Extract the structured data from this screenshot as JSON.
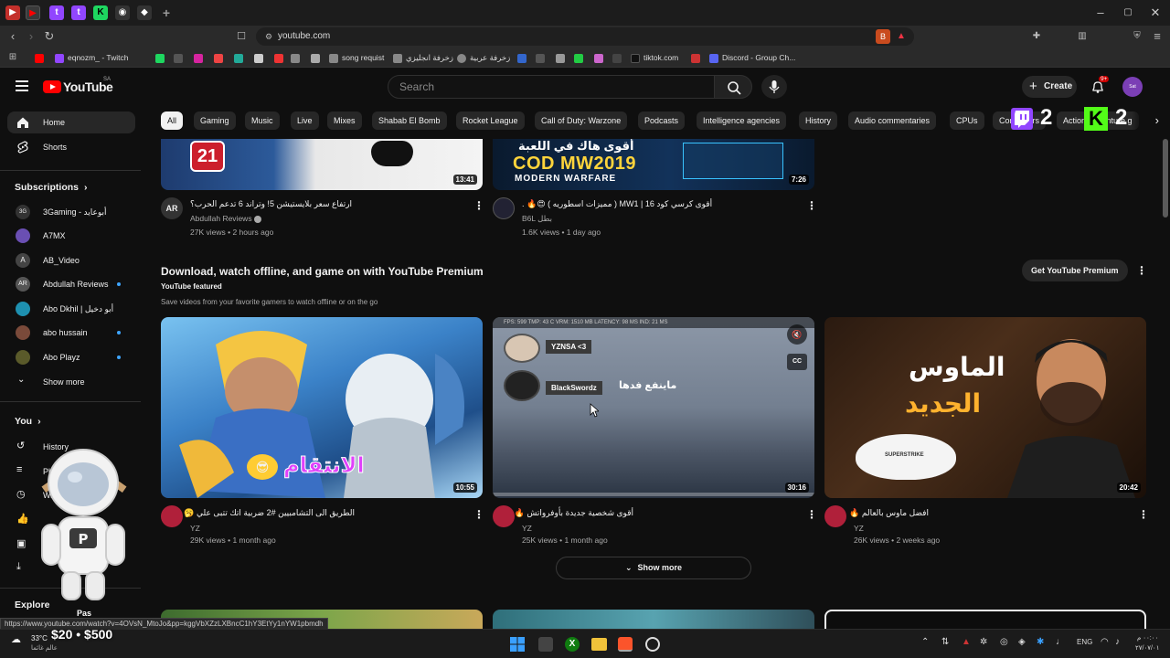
{
  "browser": {
    "url": "youtube.com",
    "bookmarks": [
      {
        "label": "eqnozm_ - Twitch",
        "color": "#9146ff"
      },
      {
        "label": "song requist",
        "color": "#888888"
      },
      {
        "label": "زخرفة انجليزي",
        "color": "#888888"
      },
      {
        "label": "زخرفة عربية",
        "color": "#888888"
      },
      {
        "label": "tiktok.com",
        "color": "#111111"
      },
      {
        "label": "Discord - Group Ch...",
        "color": "#5865f2"
      }
    ]
  },
  "youtube": {
    "logo_text": "YouTube",
    "region": "SA",
    "search_placeholder": "Search",
    "create_label": "Create",
    "notif_count": "9+",
    "avatar_text": "Sat"
  },
  "chips": [
    {
      "label": "All",
      "active": true
    },
    {
      "label": "Gaming"
    },
    {
      "label": "Music"
    },
    {
      "label": "Live"
    },
    {
      "label": "Mixes"
    },
    {
      "label": "Shabab El Bomb"
    },
    {
      "label": "Rocket League"
    },
    {
      "label": "Call of Duty: Warzone"
    },
    {
      "label": "Podcasts"
    },
    {
      "label": "Intelligence agencies"
    },
    {
      "label": "History"
    },
    {
      "label": "Audio commentaries"
    },
    {
      "label": "CPUs"
    },
    {
      "label": "Computers"
    },
    {
      "label": "Action-adventure g"
    }
  ],
  "sidebar": {
    "home": "Home",
    "shorts": "Shorts",
    "subscriptions_title": "Subscriptions",
    "subscriptions": [
      {
        "name": "3Gaming - أبوعايد",
        "color": "#333333",
        "dot": false
      },
      {
        "name": "A7MX",
        "color": "#6a4fb3",
        "dot": false
      },
      {
        "name": "AB_Video",
        "color": "#444444",
        "dot": false
      },
      {
        "name": "Abdullah Reviews",
        "color": "#555555",
        "dot": true
      },
      {
        "name": "Abo Dkhil | أبو دخيل",
        "color": "#1e90b0",
        "dot": false
      },
      {
        "name": "abo hussain",
        "color": "#7a4a3a",
        "dot": true
      },
      {
        "name": "Abo Playz",
        "color": "#5a5a2a",
        "dot": true
      }
    ],
    "show_more": "Show more",
    "you_title": "You",
    "you_items": [
      "History",
      "Playlists",
      "Watch later"
    ],
    "explore": "Explore"
  },
  "top_videos": [
    {
      "title": "ارتفاع سعر بلايستيشن 5! وتراند 6 تدعم الحرب؟",
      "channel": "Abdullah Reviews",
      "stats": "27K views • 2 hours ago",
      "duration": "13:41",
      "thumb_text": "21"
    },
    {
      "title": "أقوى كرسي كود 16 | MW1 ( مميزات اسطوريه ) 😍🔥 .",
      "channel": "B6L بطل",
      "stats": "1.6K views • 1 day ago",
      "duration": "7:26",
      "thumb_text_top": "أقوى هاك في اللعبة",
      "thumb_text_main": "COD MW2019",
      "thumb_text_sub": "MODERN WARFARE"
    }
  ],
  "premium_shelf": {
    "title": "Download, watch offline, and game on with YouTube Premium",
    "subtitle": "YouTube featured",
    "description": "Save videos from your favorite gamers to watch offline or on the go",
    "button": "Get YouTube Premium"
  },
  "premium_videos": [
    {
      "title": "الطريق الى التشامبيين #2 ضربية اتك تتبى علي 🥱",
      "channel": "YZ",
      "stats": "29K views • 1 month ago",
      "duration": "10:55",
      "thumb_text": "الانتقام"
    },
    {
      "title": "أقوى شخصية جديدة بأوفرواتش 🔥",
      "channel": "YZ",
      "stats": "25K views • 1 month ago",
      "duration": "30:16",
      "hud": "FPS: 599   TMP: 43 C   VRM: 1510 MB   LATENCY: 98 MS   IND: 21 MS",
      "name1": "YZNSA <3",
      "name2": "BlackSwordz",
      "caption": "ماينفع فدها"
    },
    {
      "title": "افضل ماوس بالعالم 🔥",
      "channel": "YZ",
      "stats": "26K views • 2 weeks ago",
      "duration": "20:42",
      "thumb_text1": "الماوس",
      "thumb_text2": "الجديد",
      "mouse_label": "SUPERSTRIKE"
    }
  ],
  "show_more_button": "Show more",
  "overlay": {
    "twitch_count": "2",
    "kick_count": "2",
    "donation_text": "$20 • $500",
    "mascot_label": "Pas"
  },
  "status_url": "https://www.youtube.com/watch?v=4OVsN_MtoJo&pp=kggVbXZzLXBncC1hY3EtYy1nYW1pbmdh",
  "taskbar": {
    "weather_temp": "33°C",
    "weather_desc": "عالم غائما",
    "lang": "ENG",
    "time": "٠٠:٠٠ م",
    "date": "٢٧/٠٧/٠١"
  }
}
